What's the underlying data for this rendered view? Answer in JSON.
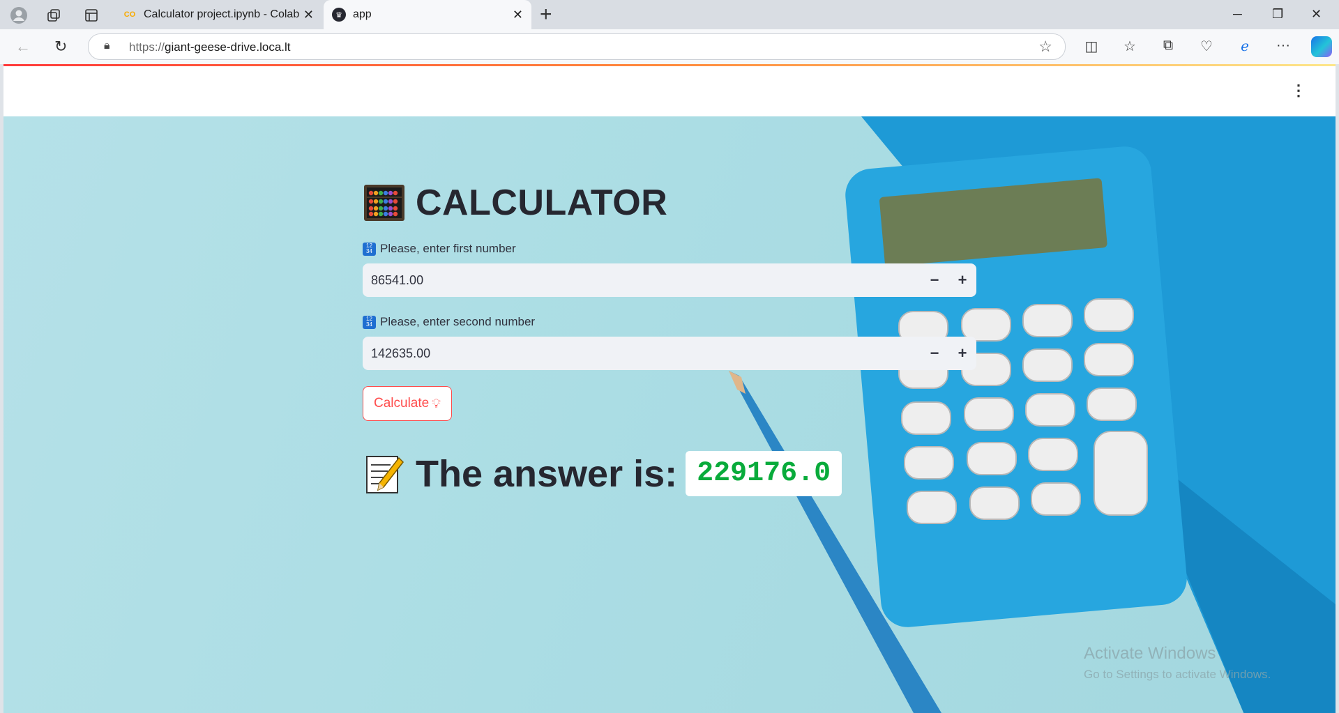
{
  "browser": {
    "tabs": [
      {
        "title": "Calculator project.ipynb - Colab",
        "favicon": "colab-icon"
      },
      {
        "title": "app",
        "favicon": "streamlit-crown-icon"
      }
    ],
    "url_scheme": "https://",
    "url_host": "giant-geese-drive.loca.lt",
    "new_tab_label": "+",
    "accent_colors": {
      "loading_bar_start": "#ff3b3b",
      "loading_bar_end": "#fde68a"
    }
  },
  "app": {
    "menu_icon": "vertical-dots-icon",
    "title": "CALCULATOR",
    "title_icon": "abacus-icon",
    "first": {
      "label": "Please, enter first number",
      "label_icon": "input-numbers-icon",
      "value": "86541.00",
      "minus": "−",
      "plus": "+"
    },
    "second": {
      "label": "Please, enter second number",
      "label_icon": "input-numbers-icon",
      "value": "142635.00",
      "minus": "−",
      "plus": "+"
    },
    "calculate_label": "Calculate",
    "calculate_icon": "light-bulb-icon",
    "answer_icon": "memo-icon",
    "answer_label": "The answer is:",
    "answer_value": "229176.0",
    "colors": {
      "primary": "#ff4b4b",
      "answer": "#09ab3b",
      "text": "#262730"
    }
  },
  "os": {
    "watermark_line1": "Activate Windows",
    "watermark_line2": "Go to Settings to activate Windows."
  }
}
